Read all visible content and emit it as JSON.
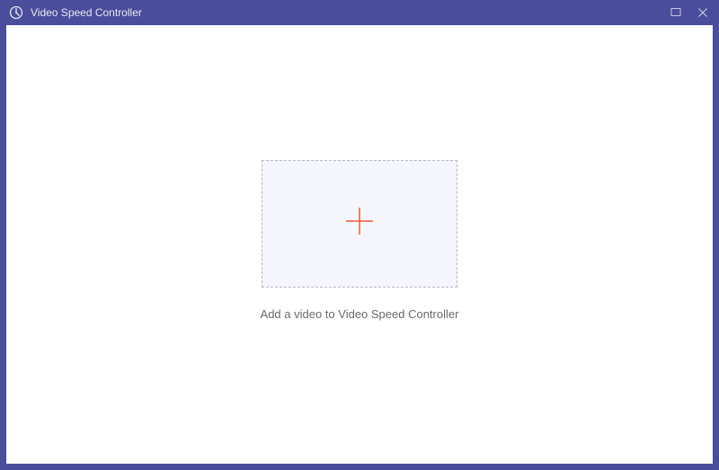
{
  "window": {
    "title": "Video Speed Controller"
  },
  "main": {
    "hint": "Add a video to Video Speed Controller"
  }
}
